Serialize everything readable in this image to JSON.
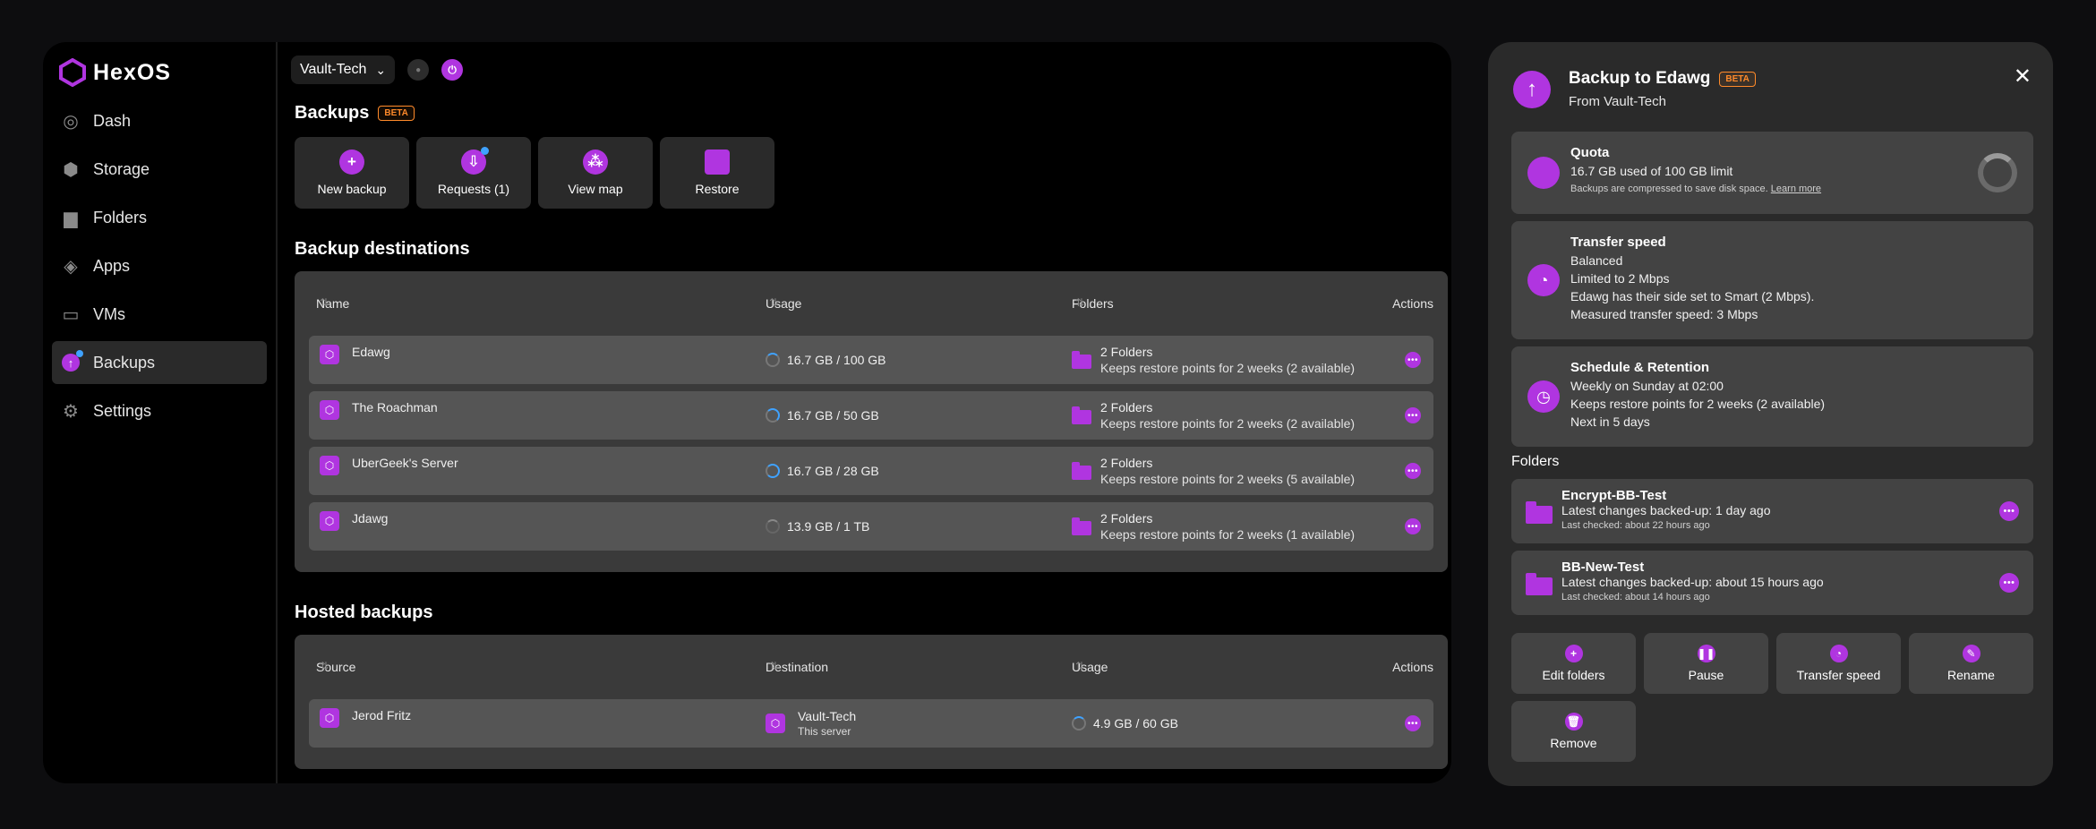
{
  "brand": {
    "name": "HexOS"
  },
  "nav": [
    {
      "label": "Dash",
      "icon": "dash-icon"
    },
    {
      "label": "Storage",
      "icon": "storage-icon"
    },
    {
      "label": "Folders",
      "icon": "folder-icon"
    },
    {
      "label": "Apps",
      "icon": "apps-icon"
    },
    {
      "label": "VMs",
      "icon": "monitor-icon"
    },
    {
      "label": "Backups",
      "icon": "backup-icon",
      "active": true
    },
    {
      "label": "Settings",
      "icon": "gear-icon"
    }
  ],
  "topbar": {
    "server": "Vault-Tech"
  },
  "backups": {
    "title": "Backups",
    "badge": "BETA",
    "actions": [
      {
        "label": "New backup",
        "icon": "plus-icon"
      },
      {
        "label": "Requests (1)",
        "icon": "inbox-icon"
      },
      {
        "label": "View map",
        "icon": "map-icon"
      },
      {
        "label": "Restore",
        "icon": "restore-icon"
      }
    ]
  },
  "destinations": {
    "title": "Backup destinations",
    "columns": {
      "name": "Name",
      "usage": "Usage",
      "folders": "Folders",
      "actions": "Actions"
    },
    "rows": [
      {
        "name": "Edawg",
        "usage": "16.7 GB / 100 GB",
        "folders": "2 Folders",
        "retention": "Keeps restore points for 2 weeks (2 available)"
      },
      {
        "name": "The Roachman",
        "usage": "16.7 GB / 50 GB",
        "folders": "2 Folders",
        "retention": "Keeps restore points for 2 weeks (2 available)"
      },
      {
        "name": "UberGeek's Server",
        "usage": "16.7 GB / 28 GB",
        "folders": "2 Folders",
        "retention": "Keeps restore points for 2 weeks (5 available)"
      },
      {
        "name": "Jdawg",
        "usage": "13.9 GB / 1 TB",
        "folders": "2 Folders",
        "retention": "Keeps restore points for 2 weeks (1 available)"
      }
    ]
  },
  "hosted": {
    "title": "Hosted backups",
    "columns": {
      "source": "Source",
      "destination": "Destination",
      "usage": "Usage",
      "actions": "Actions"
    },
    "rows": [
      {
        "source": "Jerod Fritz",
        "destination": "Vault-Tech",
        "destination_sub": "This server",
        "usage": "4.9 GB / 60 GB"
      }
    ]
  },
  "drawer": {
    "title": "Backup to Edawg",
    "badge": "BETA",
    "subtitle": "From Vault-Tech",
    "quota": {
      "title": "Quota",
      "line": "16.7 GB used of 100 GB limit",
      "note": "Backups are compressed to save disk space.",
      "link": "Learn more"
    },
    "transfer": {
      "title": "Transfer speed",
      "lines": [
        "Balanced",
        "Limited to 2 Mbps",
        "Edawg has their side set to Smart (2 Mbps).",
        "Measured transfer speed: 3 Mbps"
      ]
    },
    "schedule": {
      "title": "Schedule & Retention",
      "lines": [
        "Weekly on Sunday at 02:00",
        "Keeps restore points for 2 weeks (2 available)",
        "Next in 5 days"
      ]
    },
    "folders_label": "Folders",
    "folders": [
      {
        "name": "Encrypt-BB-Test",
        "changes": "Latest changes backed-up: 1 day ago",
        "checked": "Last checked: about 22 hours ago"
      },
      {
        "name": "BB-New-Test",
        "changes": "Latest changes backed-up: about 15 hours ago",
        "checked": "Last checked: about 14 hours ago"
      }
    ],
    "buttons": [
      {
        "label": "Edit folders",
        "icon": "plus-icon"
      },
      {
        "label": "Pause",
        "icon": "pause-icon"
      },
      {
        "label": "Transfer speed",
        "icon": "speed-icon"
      },
      {
        "label": "Rename",
        "icon": "rename-icon"
      },
      {
        "label": "Remove",
        "icon": "trash-icon"
      }
    ]
  },
  "colors": {
    "accent": "#b035e0",
    "badge": "#ff8a2a",
    "info": "#3fa2ff"
  }
}
